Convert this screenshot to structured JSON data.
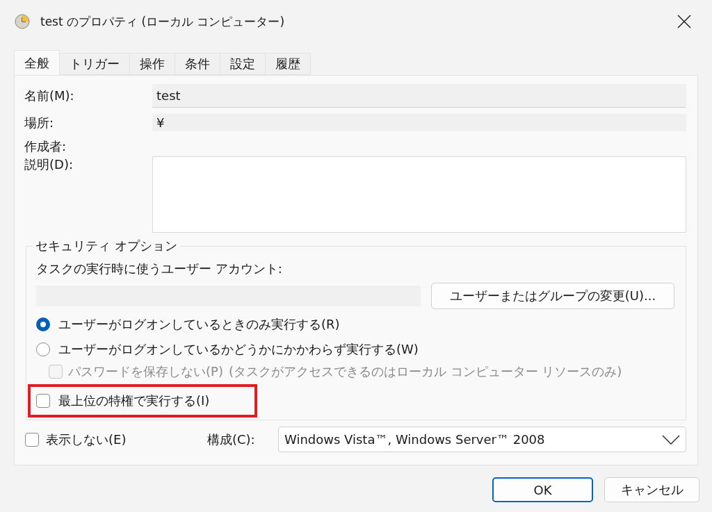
{
  "window": {
    "title": "test のプロパティ (ローカル コンピューター)"
  },
  "tabs": [
    {
      "label": "全般",
      "selected": true
    },
    {
      "label": "トリガー",
      "selected": false
    },
    {
      "label": "操作",
      "selected": false
    },
    {
      "label": "条件",
      "selected": false
    },
    {
      "label": "設定",
      "selected": false
    },
    {
      "label": "履歴",
      "selected": false
    }
  ],
  "general": {
    "name_label": "名前(M):",
    "name_value": "test",
    "location_label": "場所:",
    "location_value": "¥",
    "author_label": "作成者:",
    "description_label": "説明(D):"
  },
  "security": {
    "title": "セキュリティ オプション",
    "account_label": "タスクの実行時に使うユーザー アカウント:",
    "change_button": "ユーザーまたはグループの変更(U)...",
    "radios": [
      {
        "label": "ユーザーがログオンしているときのみ実行する(R)",
        "selected": true
      },
      {
        "label": "ユーザーがログオンしているかどうかにかかわらず実行する(W)",
        "selected": false
      }
    ],
    "password": {
      "label": "パスワードを保存しない(P)",
      "note": "(タスクがアクセスできるのはローカル コンピューター リソースのみ)",
      "checked": false,
      "disabled": true
    },
    "highest": {
      "label": "最上位の特権で実行する(I)",
      "checked": false,
      "highlighted": true
    }
  },
  "hidden": {
    "label": "表示しない(E)",
    "checked": false
  },
  "configure": {
    "label": "構成(C):",
    "value": "Windows Vista™, Windows Server™ 2008"
  },
  "buttons": [
    {
      "label": "OK",
      "kind": "default"
    },
    {
      "label": "キャンセル",
      "kind": "normal"
    }
  ]
}
